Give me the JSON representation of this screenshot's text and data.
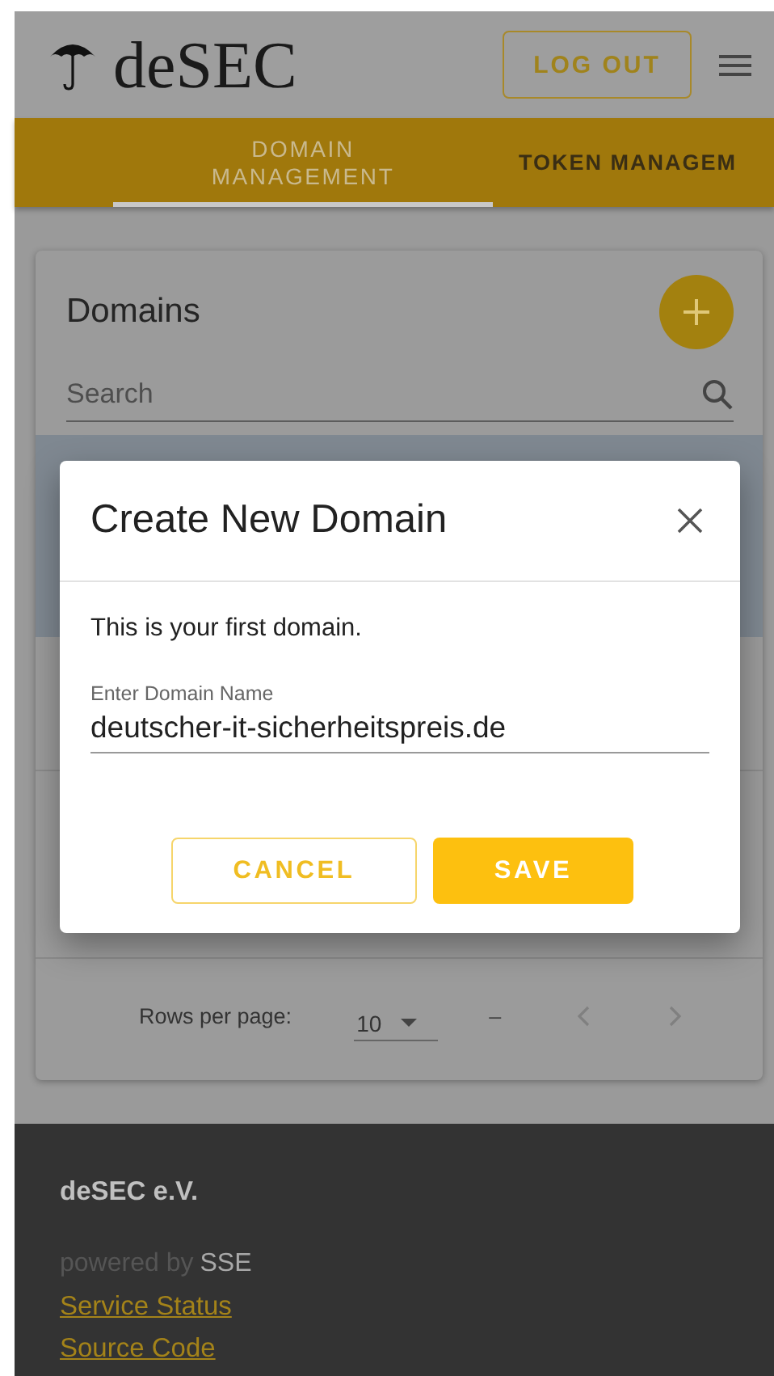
{
  "header": {
    "logo": "deSEC",
    "logout_button": "LOG OUT"
  },
  "tabs": [
    {
      "label": "DOMAIN MANAGEMENT",
      "selected": true
    },
    {
      "label": "TOKEN MANAGEM",
      "selected": false
    }
  ],
  "domains_card": {
    "title": "Domains",
    "search": {
      "placeholder": "Search"
    },
    "pagination": {
      "rows_per_page_label": "Rows per page:",
      "rows_per_page": "10",
      "range": "–"
    }
  },
  "dialog": {
    "title": "Create New Domain",
    "message": "This is your first domain.",
    "field": {
      "label": "Enter Domain Name",
      "value": "deutscher-it-sicherheitspreis.de"
    },
    "buttons": [
      {
        "label": "CANCEL",
        "kind": "outlined"
      },
      {
        "label": "SAVE",
        "kind": "filled"
      }
    ]
  },
  "footer": {
    "organization": "deSEC e.V.",
    "powered_by": "powered by",
    "sponsor": "SSE",
    "links": [
      "Service Status",
      "Source Code"
    ]
  }
}
